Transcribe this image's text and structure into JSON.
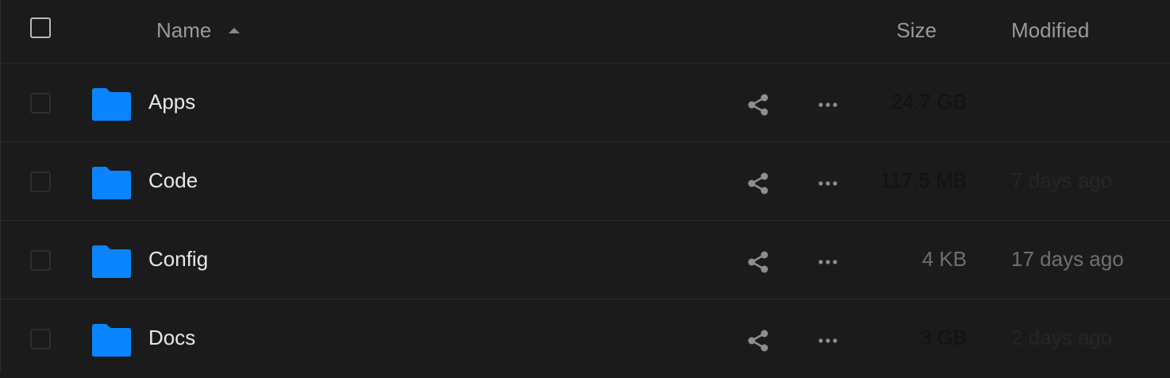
{
  "header": {
    "name_label": "Name",
    "size_label": "Size",
    "modified_label": "Modified"
  },
  "items": [
    {
      "name": "Apps",
      "size": "24.7 GB",
      "modified": ""
    },
    {
      "name": "Code",
      "size": "117.5 MB",
      "modified": "7 days ago"
    },
    {
      "name": "Config",
      "size": "4 KB",
      "modified": "17 days ago"
    },
    {
      "name": "Docs",
      "size": "3 GB",
      "modified": "2 days ago"
    }
  ],
  "colors": {
    "folder": "#0a84ff",
    "background": "#1b1b1b",
    "divider": "#2b2b2b"
  },
  "icons": {
    "folder": "folder-icon",
    "share": "share-icon",
    "more": "more-icon",
    "sort": "sort-ascending-icon"
  }
}
